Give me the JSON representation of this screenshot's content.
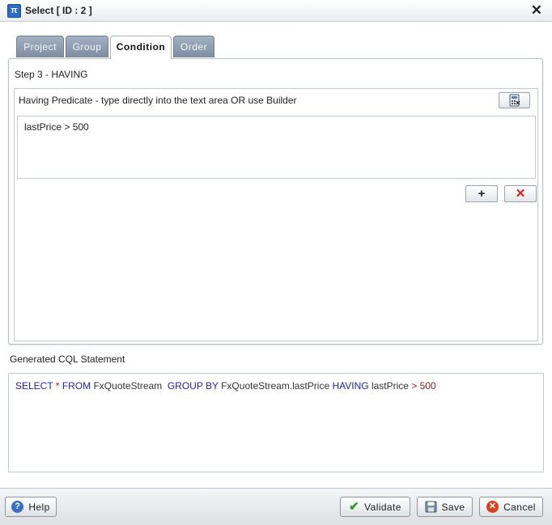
{
  "window": {
    "title": "Select [ ID : 2 ]",
    "app_icon": "pi-icon",
    "app_icon_glyph": "π"
  },
  "tabs": [
    {
      "label": "Project",
      "active": false
    },
    {
      "label": "Group",
      "active": false
    },
    {
      "label": "Condition",
      "active": true
    },
    {
      "label": "Order",
      "active": false
    }
  ],
  "step": {
    "label": "Step 3 - HAVING"
  },
  "having": {
    "label": "Having Predicate - type directly into the text area OR use Builder",
    "value": "lastPrice > 500"
  },
  "cql": {
    "label": "Generated CQL Statement",
    "tokens": [
      {
        "t": "SELECT",
        "c": "kw"
      },
      {
        "t": " * ",
        "c": "op"
      },
      {
        "t": "FROM",
        "c": "kw"
      },
      {
        "t": " FxQuoteStream  ",
        "c": "id"
      },
      {
        "t": "GROUP BY",
        "c": "kw"
      },
      {
        "t": " FxQuoteStream.lastPrice ",
        "c": "id"
      },
      {
        "t": "HAVING",
        "c": "kw"
      },
      {
        "t": " lastPrice ",
        "c": "id"
      },
      {
        "t": ">",
        "c": "op"
      },
      {
        "t": " 500",
        "c": "num"
      }
    ]
  },
  "footer": {
    "help_label": "Help",
    "validate_label": "Validate",
    "save_label": "Save",
    "cancel_label": "Cancel"
  },
  "colors": {
    "tab_inactive": "#8f9eb0",
    "keyword": "#2424b3",
    "operator": "#8b1a1a"
  }
}
